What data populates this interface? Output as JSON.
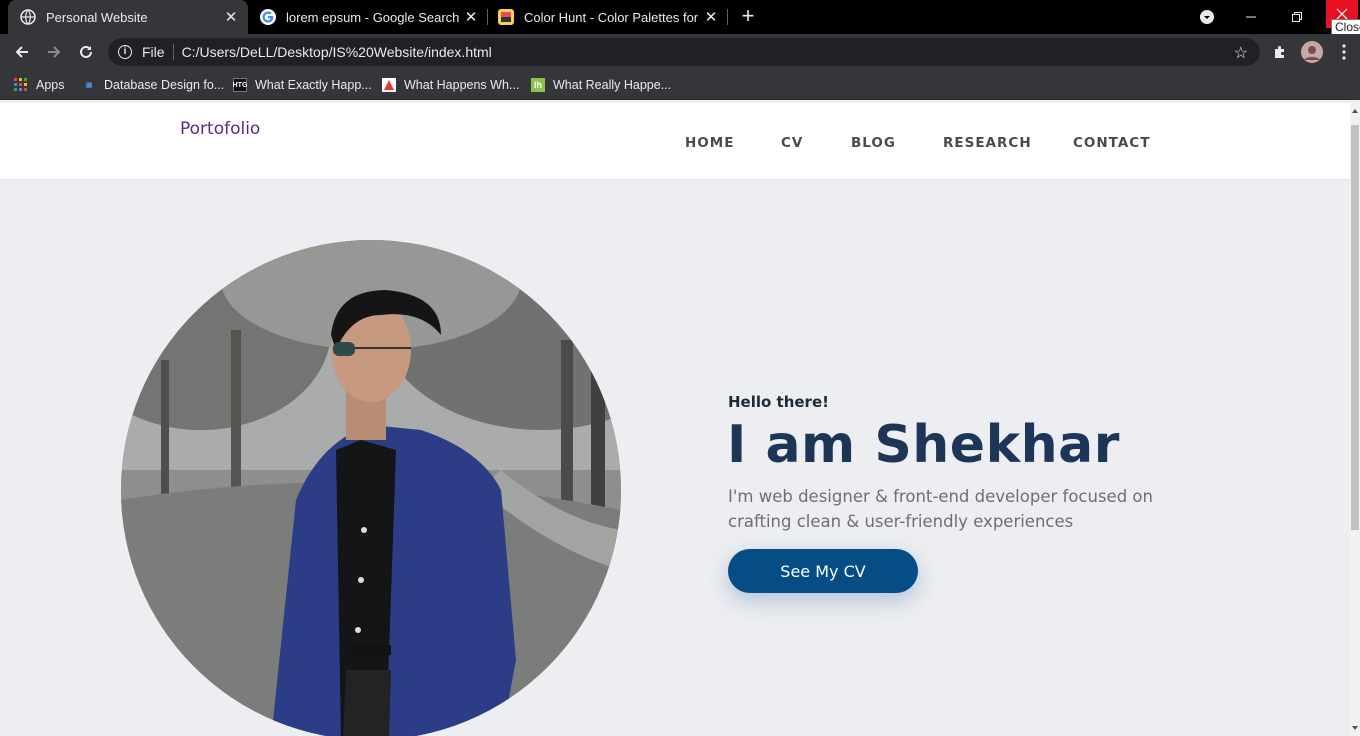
{
  "browser": {
    "tabs": [
      {
        "title": "Personal Website",
        "active": true,
        "favicon": "globe-icon"
      },
      {
        "title": "lorem epsum - Google Search",
        "active": false,
        "favicon": "google-icon"
      },
      {
        "title": "Color Hunt - Color Palettes for De",
        "active": false,
        "favicon": "colorhunt-icon"
      }
    ],
    "close_tooltip": "Close",
    "address": {
      "scheme_label": "File",
      "url": "C:/Users/DeLL/Desktop/IS%20Website/index.html"
    },
    "bookmarks": [
      {
        "label": "Apps",
        "icon": "apps-grid-icon"
      },
      {
        "label": "Database Design fo...",
        "icon": "database-icon"
      },
      {
        "label": "What Exactly Happ...",
        "icon": "htg-icon"
      },
      {
        "label": "What Happens Wh...",
        "icon": "warning-icon"
      },
      {
        "label": "What Really Happe...",
        "icon": "lh-icon"
      }
    ]
  },
  "site": {
    "logo": "Portofolio",
    "nav": [
      "HOME",
      "CV",
      "BLOG",
      "RESEARCH",
      "CONTACT"
    ],
    "hero": {
      "greeting": "Hello there!",
      "headline": "I am Shekhar",
      "tagline": "I'm web designer & front-end developer focused on crafting clean & user-friendly experiences",
      "cta_label": "See My CV"
    },
    "colors": {
      "logo": "#5b2a86",
      "headline": "#1d3557",
      "button": "#064d86",
      "background": "#eceef1"
    }
  }
}
